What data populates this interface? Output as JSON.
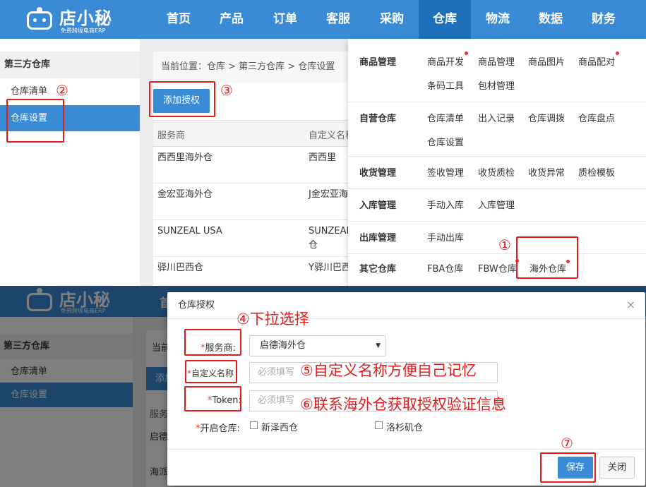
{
  "top": {
    "logo": {
      "name": "店小秘",
      "sub": "免费跨境电商ERP"
    },
    "nav": [
      "首页",
      "产品",
      "订单",
      "客服",
      "采购",
      "仓库",
      "物流",
      "数据",
      "财务"
    ],
    "sidebar": {
      "title": "第三方仓库",
      "items": [
        "仓库清单",
        "仓库设置"
      ]
    },
    "breadcrumb": "当前位置：仓库 > 第三方仓库 > 仓库设置",
    "add_button": "添加授权",
    "table": {
      "headers": [
        "服务商",
        "自定义名称"
      ],
      "rows": [
        [
          "西西里海外仓",
          "西西里"
        ],
        [
          "金宏亚海外仓",
          "J金宏亚海"
        ],
        [
          "SUNZEAL USA",
          "SUNZEAL"
        ],
        [
          "驿川巴西仓",
          "Y驿川巴西"
        ]
      ],
      "row3_extra": "仓"
    },
    "menu": {
      "categories": [
        {
          "name": "商品管理",
          "links": [
            "商品开发",
            "商品管理",
            "商品图片",
            "商品配对",
            "条码工具",
            "包材管理"
          ]
        },
        {
          "name": "自营仓库",
          "links": [
            "仓库清单",
            "出入记录",
            "仓库调拨",
            "仓库盘点",
            "仓库设置"
          ]
        },
        {
          "name": "收货管理",
          "links": [
            "签收管理",
            "收货质检",
            "收货异常",
            "质检模板"
          ]
        },
        {
          "name": "入库管理",
          "links": [
            "手动入库",
            "入库管理"
          ]
        },
        {
          "name": "出库管理",
          "links": [
            "手动出库"
          ]
        },
        {
          "name": "其它仓库",
          "links": [
            "FBA仓库",
            "FBW仓库",
            "海外仓库"
          ]
        }
      ]
    }
  },
  "bottom": {
    "nav_visible": "首",
    "sidebar": {
      "title": "第三方仓库",
      "items": [
        "仓库清单",
        "仓库设置"
      ]
    },
    "bg_fragments": [
      "当前",
      "添加",
      "服务",
      "启德",
      "海派"
    ],
    "modal": {
      "title": "仓库授权",
      "close": "×",
      "fields": {
        "provider": {
          "label": "服务商:",
          "value": "启德海外仓"
        },
        "alias": {
          "label": "自定义名称",
          "placeholder": "必须填写"
        },
        "token": {
          "label": "Token:",
          "placeholder": "必须填写"
        },
        "open": {
          "label": "开启仓库:",
          "options": [
            "新泽西仓",
            "洛杉矶仓"
          ]
        }
      },
      "save": "保存",
      "close_btn": "关闭"
    }
  },
  "annotations": {
    "n1": "①",
    "n2": "②",
    "n3": "③",
    "n4": "④下拉选择",
    "n5": "⑤自定义名称方便自己记忆",
    "n6": "⑥联系海外仓获取授权验证信息",
    "n7": "⑦",
    "color": "#e31b1b"
  },
  "colors": {
    "brand": "#3a8ad6",
    "brand_dark": "#1f6fbb",
    "required": "#e33"
  }
}
